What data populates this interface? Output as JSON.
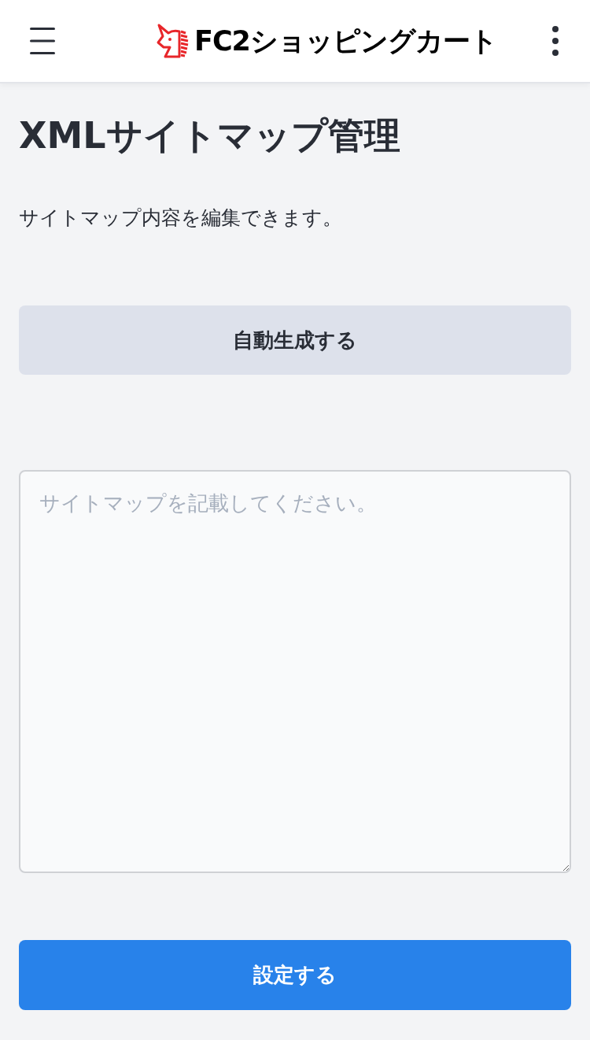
{
  "header": {
    "logo_text": "FC2ショッピングカート"
  },
  "page": {
    "title": "XMLサイトマップ管理",
    "description": "サイトマップ内容を編集できます。"
  },
  "auto_generate_button": {
    "label": "自動生成する"
  },
  "sitemap_field": {
    "placeholder": "サイトマップを記載してください。"
  },
  "submit_button": {
    "label": "設定する"
  }
}
